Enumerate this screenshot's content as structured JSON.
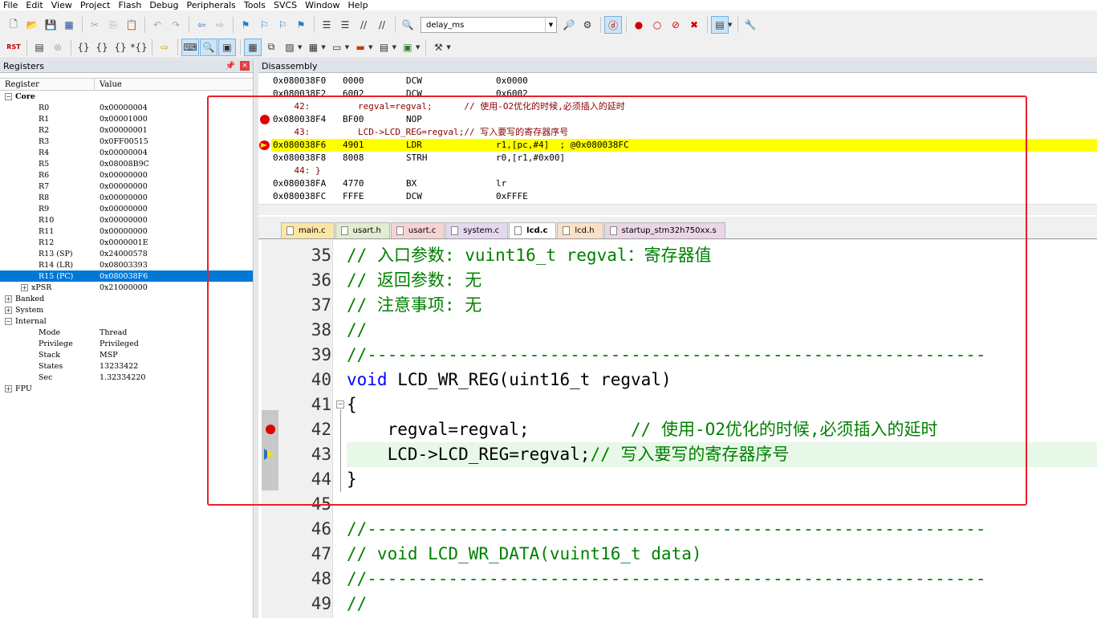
{
  "menu": [
    "File",
    "Edit",
    "View",
    "Project",
    "Flash",
    "Debug",
    "Peripherals",
    "Tools",
    "SVCS",
    "Window",
    "Help"
  ],
  "toolbar": {
    "target_value": "delay_ms",
    "rst_label": "RST"
  },
  "registers": {
    "title": "Registers",
    "col_register": "Register",
    "col_value": "Value",
    "rows": [
      {
        "name": "Core",
        "value": "",
        "tw": "−",
        "indent": 0,
        "bold": true
      },
      {
        "name": "R0",
        "value": "0x00000004",
        "indent": 1
      },
      {
        "name": "R1",
        "value": "0x00001000",
        "indent": 1
      },
      {
        "name": "R2",
        "value": "0x00000001",
        "indent": 1
      },
      {
        "name": "R3",
        "value": "0x0FF00515",
        "indent": 1
      },
      {
        "name": "R4",
        "value": "0x00000004",
        "indent": 1
      },
      {
        "name": "R5",
        "value": "0x08008B9C",
        "indent": 1
      },
      {
        "name": "R6",
        "value": "0x00000000",
        "indent": 1
      },
      {
        "name": "R7",
        "value": "0x00000000",
        "indent": 1
      },
      {
        "name": "R8",
        "value": "0x00000000",
        "indent": 1
      },
      {
        "name": "R9",
        "value": "0x00000000",
        "indent": 1
      },
      {
        "name": "R10",
        "value": "0x00000000",
        "indent": 1
      },
      {
        "name": "R11",
        "value": "0x00000000",
        "indent": 1
      },
      {
        "name": "R12",
        "value": "0x0000001E",
        "indent": 1
      },
      {
        "name": "R13 (SP)",
        "value": "0x24000578",
        "indent": 1
      },
      {
        "name": "R14 (LR)",
        "value": "0x08003393",
        "indent": 1
      },
      {
        "name": "R15 (PC)",
        "value": "0x080038F6",
        "indent": 1,
        "selected": true
      },
      {
        "name": "xPSR",
        "value": "0x21000000",
        "indent": 1,
        "tw": "+"
      },
      {
        "name": "Banked",
        "value": "",
        "tw": "+",
        "indent": 0
      },
      {
        "name": "System",
        "value": "",
        "tw": "+",
        "indent": 0
      },
      {
        "name": "Internal",
        "value": "",
        "tw": "−",
        "indent": 0
      },
      {
        "name": "Mode",
        "value": "Thread",
        "indent": 1
      },
      {
        "name": "Privilege",
        "value": "Privileged",
        "indent": 1
      },
      {
        "name": "Stack",
        "value": "MSP",
        "indent": 1
      },
      {
        "name": "States",
        "value": "13233422",
        "indent": 1
      },
      {
        "name": "Sec",
        "value": "1.32334220",
        "indent": 1
      },
      {
        "name": "FPU",
        "value": "",
        "tw": "+",
        "indent": 0
      }
    ]
  },
  "disassembly": {
    "title": "Disassembly",
    "lines": [
      {
        "addr": "0x080038F0",
        "op": "0000",
        "mn": "DCW",
        "args": "0x0000",
        "kind": "asm"
      },
      {
        "addr": "0x080038F2",
        "op": "6002",
        "mn": "DCW",
        "args": "0x6002",
        "kind": "asm"
      },
      {
        "src": "    42:         regval=regval;      // 使用-O2优化的时候,必须插入的延时",
        "kind": "src"
      },
      {
        "addr": "0x080038F4",
        "op": "BF00",
        "mn": "NOP",
        "args": "",
        "kind": "asm",
        "bp": true
      },
      {
        "src": "    43:         LCD->LCD_REG=regval;// 写入要写的寄存器序号",
        "kind": "src"
      },
      {
        "addr": "0x080038F6",
        "op": "4901",
        "mn": "LDR",
        "args": "r1,[pc,#4]  ; @0x080038FC",
        "kind": "asm",
        "current": true
      },
      {
        "addr": "0x080038F8",
        "op": "8008",
        "mn": "STRH",
        "args": "r0,[r1,#0x00]",
        "kind": "asm"
      },
      {
        "src": "    44: }",
        "kind": "src"
      },
      {
        "addr": "0x080038FA",
        "op": "4770",
        "mn": "BX",
        "args": "lr",
        "kind": "asm"
      },
      {
        "addr": "0x080038FC",
        "op": "FFFE",
        "mn": "DCW",
        "args": "0xFFFE",
        "kind": "asm"
      }
    ]
  },
  "tabs": [
    {
      "label": "main.c",
      "color": "#fbe6a6"
    },
    {
      "label": "usart.h",
      "color": "#e2ecd0"
    },
    {
      "label": "usart.c",
      "color": "#f6d3d3"
    },
    {
      "label": "system.c",
      "color": "#e4d8f0"
    },
    {
      "label": "lcd.c",
      "color": "#ffffff",
      "active": true
    },
    {
      "label": "lcd.h",
      "color": "#fbe0c8"
    },
    {
      "label": "startup_stm32h750xx.s",
      "color": "#ead6e6"
    }
  ],
  "editor": {
    "lines": [
      {
        "n": "35",
        "parts": [
          {
            "t": "// 入口参数: vuint16_t regval：寄存器值",
            "c": "cmt"
          }
        ]
      },
      {
        "n": "36",
        "parts": [
          {
            "t": "// 返回参数: 无",
            "c": "cmt"
          }
        ]
      },
      {
        "n": "37",
        "parts": [
          {
            "t": "// 注意事项: 无",
            "c": "cmt"
          }
        ]
      },
      {
        "n": "38",
        "parts": [
          {
            "t": "//",
            "c": "cmt"
          }
        ]
      },
      {
        "n": "39",
        "parts": [
          {
            "t": "//-------------------------------------------------------------",
            "c": "cmt"
          }
        ]
      },
      {
        "n": "40",
        "parts": [
          {
            "t": "void",
            "c": "kw"
          },
          {
            "t": " LCD_WR_REG(uint16_t regval)",
            "c": "plain"
          }
        ]
      },
      {
        "n": "41",
        "parts": [
          {
            "t": "{",
            "c": "plain"
          }
        ],
        "fold": true
      },
      {
        "n": "42",
        "parts": [
          {
            "t": "    regval=regval;          ",
            "c": "plain"
          },
          {
            "t": "// 使用-O2优化的时候,必须插入的延时",
            "c": "cmt"
          }
        ],
        "bp": true
      },
      {
        "n": "43",
        "parts": [
          {
            "t": "    LCD->LCD_REG=regval;",
            "c": "plain"
          },
          {
            "t": "// 写入要写的寄存器序号",
            "c": "cmt"
          }
        ],
        "current": true
      },
      {
        "n": "44",
        "parts": [
          {
            "t": "}",
            "c": "plain"
          }
        ]
      },
      {
        "n": "45",
        "parts": []
      },
      {
        "n": "46",
        "parts": [
          {
            "t": "//-------------------------------------------------------------",
            "c": "cmt"
          }
        ]
      },
      {
        "n": "47",
        "parts": [
          {
            "t": "// void LCD_WR_DATA(vuint16_t data)",
            "c": "cmt"
          }
        ]
      },
      {
        "n": "48",
        "parts": [
          {
            "t": "//-------------------------------------------------------------",
            "c": "cmt"
          }
        ]
      },
      {
        "n": "49",
        "parts": [
          {
            "t": "//",
            "c": "cmt"
          }
        ]
      }
    ]
  },
  "colors": {
    "highlight": "#e8202a",
    "current_line": "#ffff00",
    "comment": "#008000",
    "keyword": "#0000ff",
    "selection": "#0078d7"
  }
}
